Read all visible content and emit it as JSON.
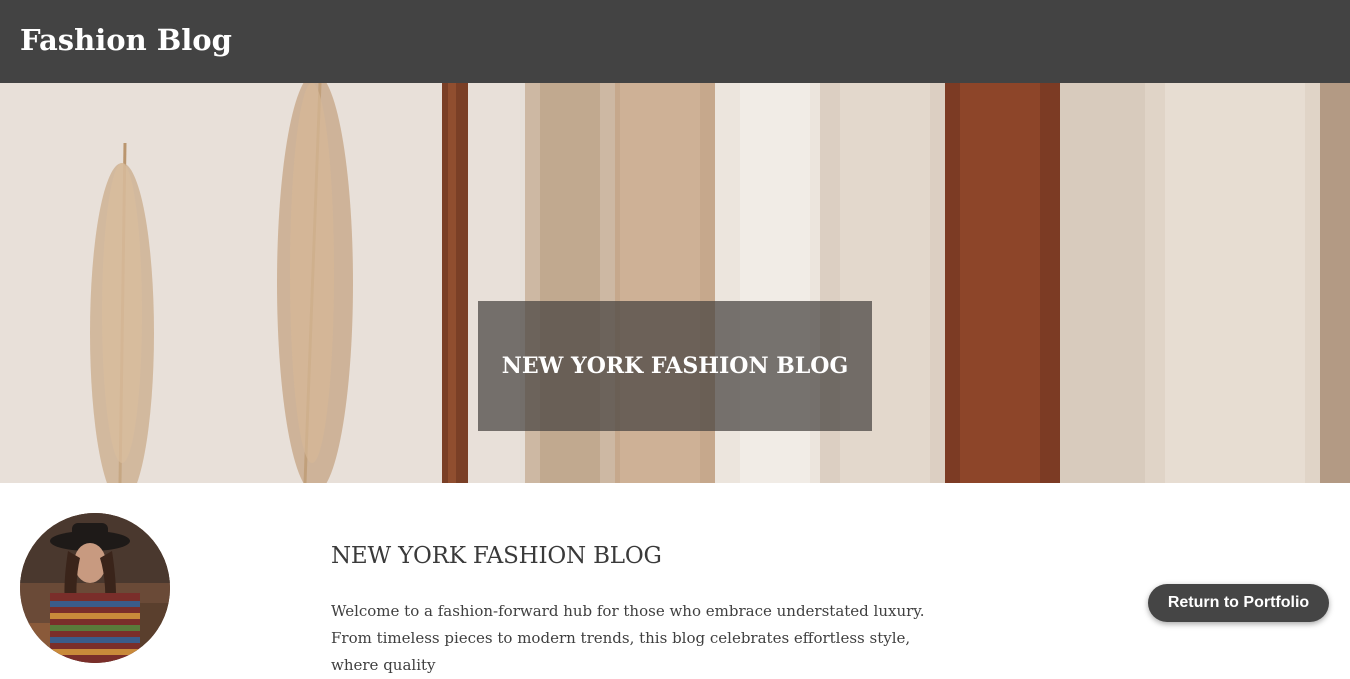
{
  "header": {
    "site_title": "Fashion Blog"
  },
  "hero": {
    "title": "NEW YORK FASHION BLOG",
    "image_icon": "clothing-rack-photo"
  },
  "content": {
    "section_title": "NEW YORK FASHION BLOG",
    "intro_text": "Welcome to a fashion-forward hub for those who embrace understated luxury. From timeless pieces to modern trends, this blog celebrates effortless style, where quality"
  },
  "actions": {
    "return_label": "Return to Portfolio"
  },
  "colors": {
    "topbar": "#434343",
    "overlay": "#464240",
    "button": "#454545",
    "text": "#3a3a3a"
  }
}
